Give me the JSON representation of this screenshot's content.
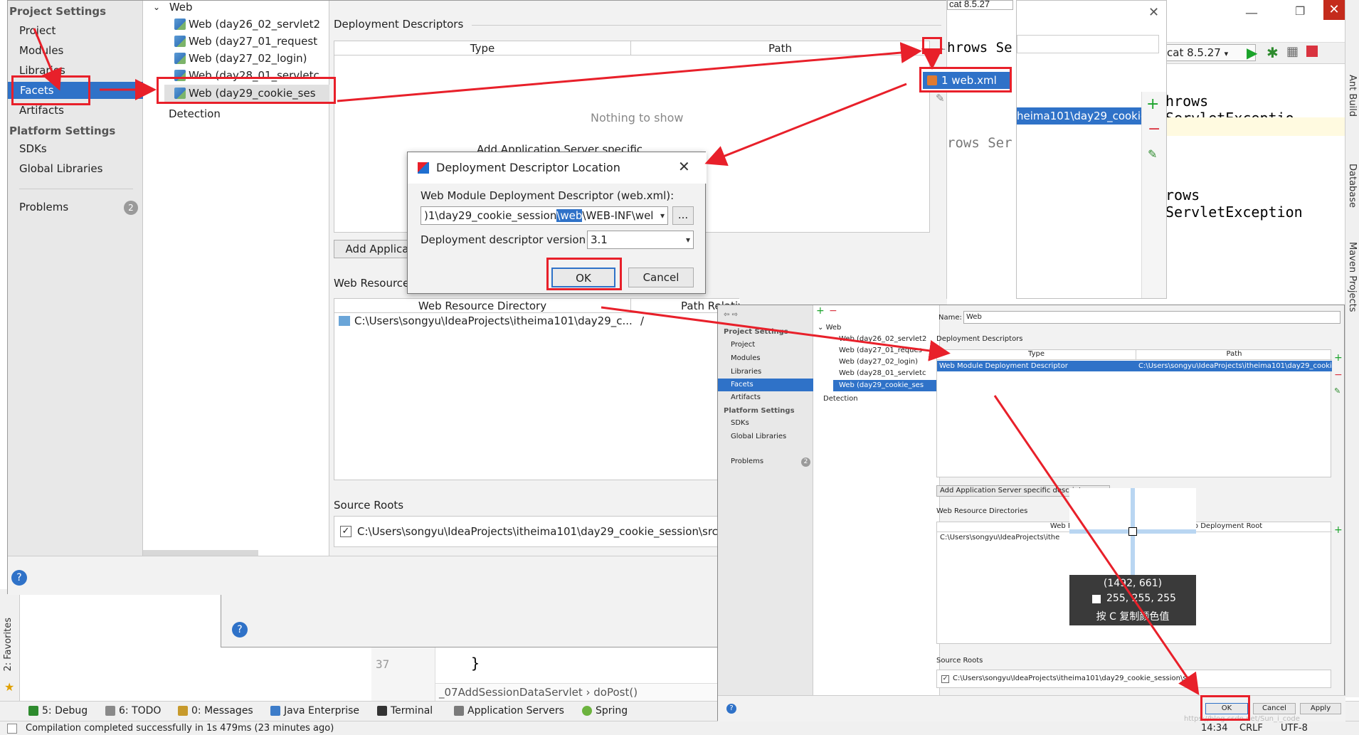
{
  "ps": {
    "nav_project_settings": "Project Settings",
    "nav_project": "Project",
    "nav_modules": "Modules",
    "nav_libraries": "Libraries",
    "nav_facets": "Facets",
    "nav_artifacts": "Artifacts",
    "nav_platform_settings": "Platform Settings",
    "nav_sdks": "SDKs",
    "nav_global_libraries": "Global Libraries",
    "nav_problems": "Problems",
    "problems_count": "2",
    "tree_web": "Web",
    "tree_items": [
      "Web (day26_02_servlet2",
      "Web (day27_01_request",
      "Web (day27_02_login)",
      "Web (day28_01_servletc",
      "Web (day29_cookie_ses"
    ],
    "tree_detection": "Detection",
    "deployment_descriptors": "Deployment Descriptors",
    "col_type": "Type",
    "col_path": "Path",
    "nothing_to_show": "Nothing to show",
    "add_app_server_partial": "Add Application Server specific descripto",
    "add_applic_button": "Add Applica",
    "web_resource_label": "Web Resource D",
    "col_web_resource_dir": "Web Resource Directory",
    "col_path_relative": "Path Relative to Deployment Root",
    "web_resource_row_dir": "C:\\Users\\songyu\\IdeaProjects\\itheima101\\day29_c...",
    "web_resource_row_path": "/",
    "source_roots": "Source Roots",
    "source_root_path": "C:\\Users\\songyu\\IdeaProjects\\itheima101\\day29_cookie_session\\src",
    "help": "?"
  },
  "ddl": {
    "title": "Deployment Descriptor Location",
    "web_module_label": "Web Module Deployment Descriptor (web.xml):",
    "path_prefix": ")1\\day29_cookie_session",
    "path_highlight": "\\web",
    "path_suffix": "\\WEB-INF\\wel",
    "browse": "...",
    "version_label": "Deployment descriptor version",
    "version_value": "3.1",
    "ok": "OK",
    "cancel": "Cancel"
  },
  "popup": {
    "item": "1  web.xml"
  },
  "editor": {
    "top_combo": "cat 8.5.27",
    "run_combo": "cat 8.5.27",
    "code_throws_1": "hrows Se",
    "code_throws_2": "hrows ServletExceptio",
    "code_throws_3": "rows Ser",
    "code_throws_4": "rows ServletException",
    "web_path": "heima101\\day29_cookie",
    "line_37": "37",
    "brace": "}",
    "breadcrumb": "_07AddSessionDataServlet  ›  doPost()",
    "side_ant": "Ant Build",
    "side_database": "Database",
    "side_maven": "Maven Projects",
    "side_favorites": "2: Favorites"
  },
  "bottombar": {
    "debug": "5: Debug",
    "todo": "6: TODO",
    "messages": "0: Messages",
    "java_enterprise": "Java Enterprise",
    "terminal": "Terminal",
    "app_servers": "Application Servers",
    "spring": "Spring"
  },
  "status": {
    "message": "Compilation completed successfully in 1s 479ms (23 minutes ago)",
    "time": "14:34",
    "crlf": "CRLF",
    "encoding": "UTF-8"
  },
  "ss2": {
    "name_label": "Name:",
    "name_value": "Web",
    "project_settings": "Project Settings",
    "project": "Project",
    "modules": "Modules",
    "libraries": "Libraries",
    "facets": "Facets",
    "artifacts": "Artifacts",
    "platform_settings": "Platform Settings",
    "sdks": "SDKs",
    "global_libraries": "Global Libraries",
    "problems": "Problems",
    "problems_count": "2",
    "tree_web": "Web",
    "tree_items": [
      "Web (day26_02_servlet2",
      "Web (day27_01_reques",
      "Web (day27_02_login)",
      "Web (day28_01_servletc",
      "Web (day29_cookie_ses"
    ],
    "detection": "Detection",
    "deployment_descriptors": "Deployment Descriptors",
    "col_type": "Type",
    "col_path": "Path",
    "row_type": "Web Module Deployment Descriptor",
    "row_path": "C:\\Users\\songyu\\IdeaProjects\\itheima101\\day29_cookie",
    "add_app_server": "Add Application Server specific descriptor...",
    "web_resource_dirs": "Web Resource Directories",
    "col_web_resource_dir": "Web Resource Directo",
    "col_relative": "elative to Deployment Root",
    "row_dir": "C:\\Users\\songyu\\IdeaProjects\\ithe",
    "source_roots": "Source Roots",
    "source_root_path": "C:\\Users\\songyu\\IdeaProjects\\itheima101\\day29_cookie_session\\src",
    "ok": "OK",
    "cancel": "Cancel",
    "apply": "Apply",
    "watermark": "https://blog.csdn.net/Sun_i_code"
  },
  "magnifier": {
    "coords": "(1492, 661)",
    "rgb": "255, 255, 255",
    "hint": "按 C 复制颜色值"
  },
  "colors": {
    "annotation_red": "#e8202a",
    "selection_blue": "#2f72c8",
    "title_close": "#c42b1c"
  }
}
